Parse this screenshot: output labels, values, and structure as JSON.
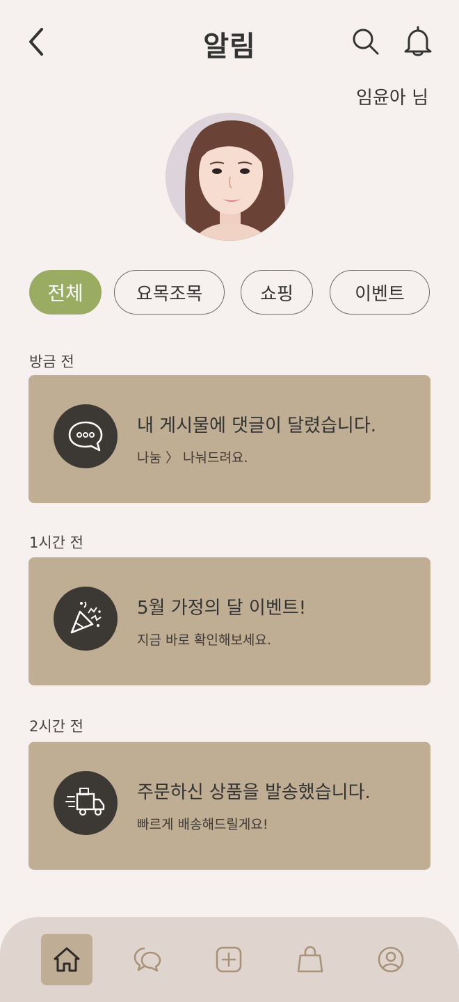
{
  "header": {
    "title": "알림",
    "user_name": "임윤아 님"
  },
  "filters": [
    {
      "label": "전체",
      "active": true
    },
    {
      "label": "요목조목",
      "active": false
    },
    {
      "label": "쇼핑",
      "active": false
    },
    {
      "label": "이벤트",
      "active": false
    }
  ],
  "notifications": [
    {
      "time": "방금 전",
      "icon": "speech-bubble-dots-icon",
      "title": "내 게시물에 댓글이 달렸습니다.",
      "subtitle": "나눔 〉 나눠드려요."
    },
    {
      "time": "1시간 전",
      "icon": "party-popper-icon",
      "title": "5월 가정의 달 이벤트!",
      "subtitle": "지금 바로 확인해보세요."
    },
    {
      "time": "2시간 전",
      "icon": "delivery-truck-icon",
      "title": "주문하신 상품을 발송했습니다.",
      "subtitle": "빠르게 배송해드릴게요!"
    }
  ],
  "bottom_nav": [
    {
      "icon": "home-icon",
      "active": true
    },
    {
      "icon": "chat-bubbles-icon",
      "active": false
    },
    {
      "icon": "add-square-icon",
      "active": false
    },
    {
      "icon": "shopping-bag-icon",
      "active": false
    },
    {
      "icon": "profile-icon",
      "active": false
    }
  ],
  "colors": {
    "background": "#f6f1ee",
    "accent_green": "#9aac62",
    "card": "#bfad94",
    "icon_circle": "#3c3834",
    "nav_bar": "#e0d4cf",
    "nav_active": "#c0ad95"
  }
}
